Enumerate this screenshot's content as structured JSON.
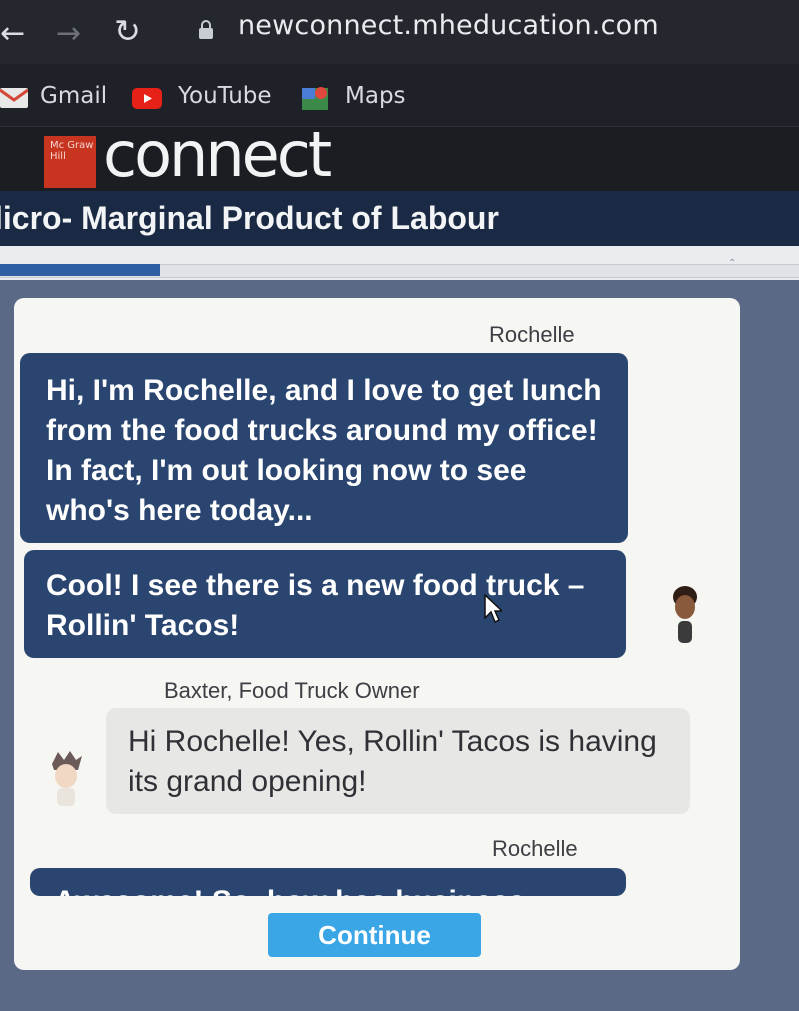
{
  "browser": {
    "url": "newconnect.mheducation.com",
    "bookmarks": [
      "Gmail",
      "YouTube",
      "Maps"
    ]
  },
  "header": {
    "logo_text": "Mc Graw Hill",
    "brand": "connect"
  },
  "page": {
    "title": "licro- Marginal Product of Labour",
    "progress_fraction": 0.2
  },
  "chat": {
    "messages": [
      {
        "speaker": "Rochelle",
        "text": "Hi, I'm Rochelle, and I love to get lunch from the food trucks around my office! In fact, I'm out looking now to see who's here today..."
      },
      {
        "speaker": "",
        "text": "Cool! I see there is a new food truck – Rollin' Tacos!"
      },
      {
        "speaker": "Baxter, Food Truck Owner",
        "text": "Hi Rochelle! Yes, Rollin' Tacos is having its grand opening!"
      },
      {
        "speaker": "Rochelle",
        "text": "Awesome! So, how has business"
      }
    ]
  },
  "continue_label": "Continue",
  "colors": {
    "accent": "#3aa6e6",
    "bubble_dark": "#2a4670",
    "title_bar": "#1a2a44"
  },
  "icons": [
    "back-arrow-icon",
    "forward-arrow-icon",
    "reload-icon",
    "lock-icon",
    "gmail-icon",
    "youtube-icon",
    "maps-icon",
    "cursor-icon"
  ]
}
